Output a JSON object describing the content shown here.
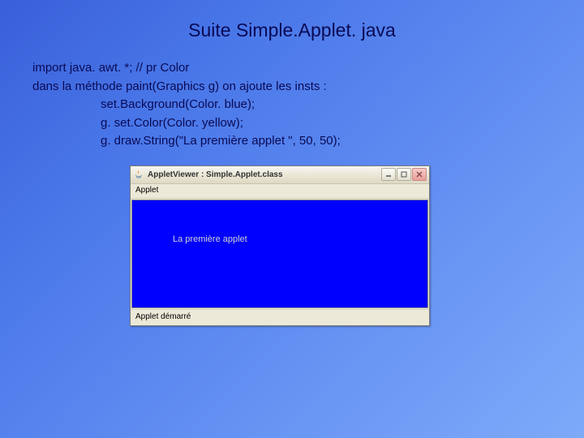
{
  "title": "Suite Simple.Applet. java",
  "text": {
    "line1": "import java. awt. *; // pr Color",
    "line2": "dans la méthode paint(Graphics g) on ajoute les insts :",
    "inst1": "set.Background(Color. blue);",
    "inst2": "g. set.Color(Color. yellow);",
    "inst3": "g. draw.String(\"La première applet \", 50, 50);"
  },
  "applet": {
    "window_title": "AppletViewer : Simple.Applet.class",
    "menu": "Applet",
    "canvas_text": "La première applet",
    "status": "Applet démarré"
  }
}
